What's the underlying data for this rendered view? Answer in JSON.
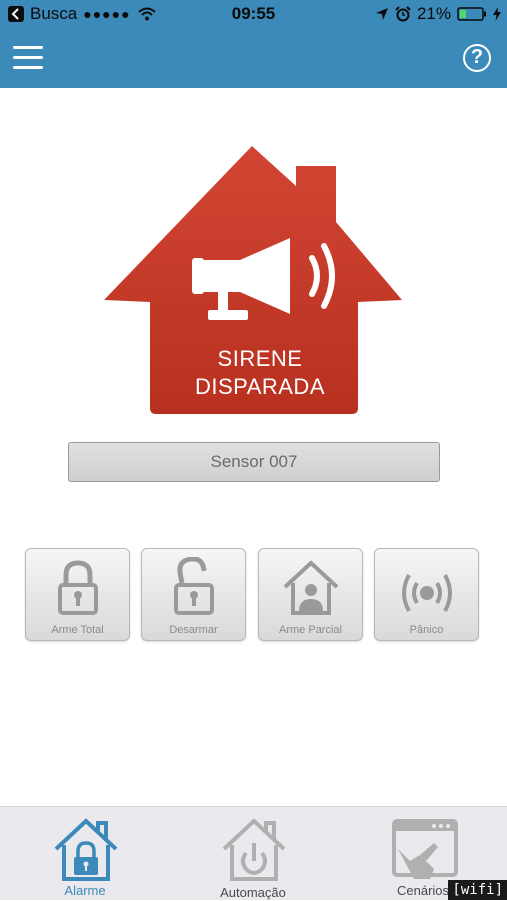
{
  "status_bar": {
    "back_app": "Busca",
    "signal_dots": "●●●●●",
    "time": "09:55",
    "battery_percent": "21%"
  },
  "nav": {
    "menu_icon": "hamburger-icon",
    "help_icon": "help-icon",
    "help_glyph": "?"
  },
  "hero": {
    "icon": "megaphone-icon",
    "line1": "SIRENE",
    "line2": "DISPARADA",
    "color": "#c6392b"
  },
  "sensor": {
    "label": "Sensor 007"
  },
  "actions": [
    {
      "label": "Arme Total",
      "icon": "lock-closed-icon"
    },
    {
      "label": "Desarmar",
      "icon": "lock-open-icon"
    },
    {
      "label": "Arme Parcial",
      "icon": "house-user-icon"
    },
    {
      "label": "Pânico",
      "icon": "broadcast-icon"
    }
  ],
  "tabs": [
    {
      "label": "Alarme",
      "icon": "house-lock-icon",
      "active": true,
      "color": "#3b8ab9"
    },
    {
      "label": "Automação",
      "icon": "house-power-icon",
      "active": false,
      "color": "#4a4a4a"
    },
    {
      "label": "Cenários",
      "icon": "window-hand-icon",
      "active": false,
      "color": "#4a4a4a"
    }
  ],
  "wifi_tag": "[wifi]",
  "colors": {
    "header": "#3b8ab9",
    "accent": "#3b8ab9",
    "siren": "#c6392b"
  }
}
